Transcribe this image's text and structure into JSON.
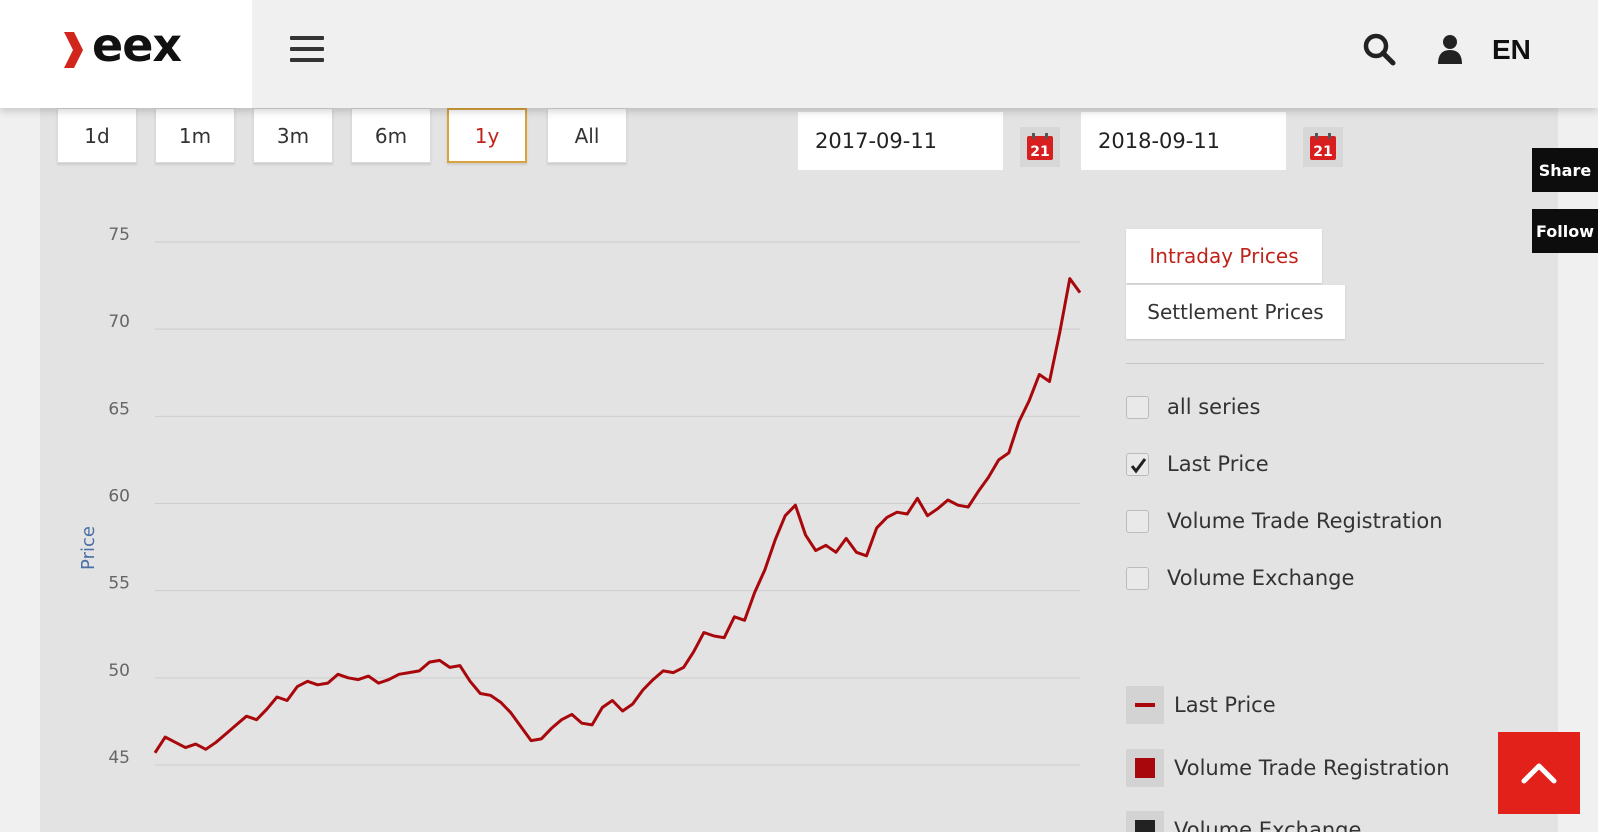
{
  "header": {
    "logo_text": "eex",
    "lang": "EN"
  },
  "range_buttons": [
    "1d",
    "1m",
    "3m",
    "6m",
    "1y",
    "All"
  ],
  "active_range": "1y",
  "date_from": "2017-09-11",
  "date_to": "2018-09-11",
  "calendar_day": "21",
  "side": {
    "share": "Share",
    "follow": "Follow"
  },
  "tabs": {
    "intraday": "Intraday Prices",
    "settlement": "Settlement Prices"
  },
  "series_toggles": [
    {
      "label": "all series",
      "checked": false
    },
    {
      "label": "Last Price",
      "checked": true
    },
    {
      "label": "Volume Trade Registration",
      "checked": false
    },
    {
      "label": "Volume Exchange",
      "checked": false
    }
  ],
  "legend": [
    {
      "label": "Last Price",
      "symbol": "line",
      "color": "#a8080c"
    },
    {
      "label": "Volume Trade Registration",
      "symbol": "square",
      "color": "#a8080c"
    },
    {
      "label": "Volume Exchange",
      "symbol": "square",
      "color": "#222222"
    }
  ],
  "colors": {
    "brand_red": "#d0261c",
    "series": "#a8080c",
    "axis_label": "#4a6fa5"
  },
  "chart_data": {
    "type": "line",
    "ylabel": "Price",
    "xlabel": "",
    "ylim": [
      45,
      75
    ],
    "yticks": [
      75,
      70,
      65,
      60,
      55,
      50,
      45
    ],
    "grid": true,
    "series": [
      {
        "name": "Last Price",
        "x": [
          0,
          4,
          8,
          12,
          16,
          20,
          24,
          28,
          32,
          36,
          40,
          44,
          48,
          52,
          56,
          60,
          64,
          68,
          72,
          76,
          80,
          84,
          88,
          92,
          96,
          100,
          104,
          108,
          112,
          116,
          120,
          124,
          128,
          132,
          136,
          140,
          144,
          148,
          152,
          156,
          160,
          164,
          168,
          172,
          176,
          180,
          184,
          188,
          192,
          196,
          200,
          204,
          208,
          212,
          216,
          220,
          224,
          228,
          232,
          236,
          240,
          244,
          248,
          252,
          256,
          260,
          264,
          268,
          272,
          276,
          280,
          284,
          288,
          292,
          296,
          300,
          304,
          308,
          312,
          316,
          320,
          324,
          328,
          332,
          336,
          340,
          344,
          348,
          352,
          356,
          360,
          364
        ],
        "values": [
          45.7,
          46.6,
          46.3,
          46.0,
          46.2,
          45.9,
          46.3,
          46.8,
          47.3,
          47.8,
          47.6,
          48.2,
          48.9,
          48.7,
          49.5,
          49.8,
          49.6,
          49.7,
          50.2,
          50.0,
          49.9,
          50.1,
          49.7,
          49.9,
          50.2,
          50.3,
          50.4,
          50.9,
          51.0,
          50.6,
          50.7,
          49.8,
          49.1,
          49.0,
          48.6,
          48.0,
          47.2,
          46.4,
          46.5,
          47.1,
          47.6,
          47.9,
          47.4,
          47.3,
          48.3,
          48.7,
          48.1,
          48.5,
          49.3,
          49.9,
          50.4,
          50.3,
          50.6,
          51.5,
          52.6,
          52.4,
          52.3,
          53.5,
          53.3,
          54.9,
          56.2,
          57.9,
          59.3,
          59.9,
          58.2,
          57.3,
          57.6,
          57.2,
          58.0,
          57.2,
          57.0,
          58.6,
          59.2,
          59.5,
          59.4,
          60.3,
          59.3,
          59.7,
          60.2,
          59.9,
          59.8,
          60.7,
          61.5,
          62.5,
          62.9,
          64.7,
          65.9,
          67.4,
          67.0,
          69.8,
          72.9,
          72.1
        ]
      }
    ]
  }
}
